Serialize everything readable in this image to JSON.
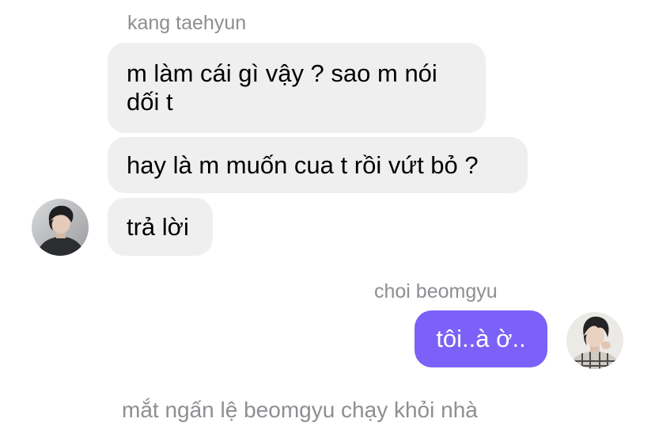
{
  "conversation": {
    "incoming": {
      "sender_name": "kang taehyun",
      "avatar_icon": "profile-photo",
      "messages": [
        "m làm cái gì vậy ? sao m nói dối t",
        "hay là m muốn cua t rồi vứt bỏ ?",
        "trả lời"
      ]
    },
    "outgoing": {
      "sender_name": "choi beomgyu",
      "avatar_icon": "profile-photo",
      "messages": [
        "tôi..à ờ.."
      ]
    },
    "narration": "mắt ngấn lệ beomgyu chạy khỏi nhà"
  },
  "colors": {
    "incoming_bubble": "#efeff0",
    "outgoing_bubble": "#7b61f8",
    "name_text": "#8e8e93"
  }
}
